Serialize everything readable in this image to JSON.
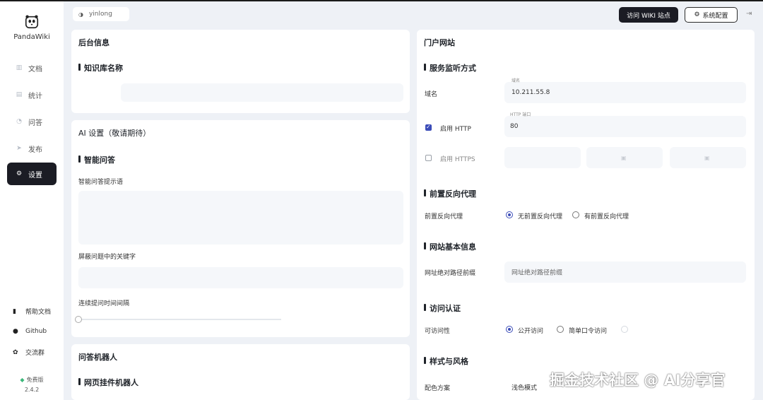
{
  "app": {
    "name": "PandaWiki",
    "version_badge": "免费版",
    "version": "2.4.2"
  },
  "sidebar": {
    "items": [
      {
        "label": "文档",
        "icon": "doc-icon"
      },
      {
        "label": "统计",
        "icon": "chart-icon"
      },
      {
        "label": "问答",
        "icon": "chat-icon"
      },
      {
        "label": "发布",
        "icon": "send-icon"
      },
      {
        "label": "设置",
        "icon": "gear-icon",
        "active": true
      }
    ],
    "bottom": [
      {
        "label": "帮助文档",
        "icon": "book-icon"
      },
      {
        "label": "Github",
        "icon": "github-icon"
      },
      {
        "label": "交流群",
        "icon": "group-icon"
      }
    ]
  },
  "topbar": {
    "user": "yinlong",
    "visit_wiki": "访问 WIKI 站点",
    "system_config": "系统配置"
  },
  "left": {
    "backend": {
      "title": "后台信息",
      "kb_name_section": "知识库名称",
      "kb_name_value": ""
    },
    "ai": {
      "title": "AI 设置（敬请期待）",
      "section": "智能问答",
      "prompt_label": "智能问答提示语",
      "prompt_placeholder": "",
      "blocked_label": "屏蔽问题中的关键字",
      "blocked_placeholder": "",
      "interval_label": "连续提问时间间隔"
    },
    "robot": {
      "title": "问答机器人",
      "section": "网页挂件机器人"
    }
  },
  "right": {
    "title": "门户网站",
    "listen": {
      "section": "服务监听方式",
      "domain_label": "域名",
      "domain_field_label": "域名",
      "domain_value": "10.211.55.8",
      "http_label": "启用 HTTP",
      "http_checked": true,
      "http_port_label": "HTTP 端口",
      "http_port_value": "80",
      "https_label": "启用 HTTPS",
      "https_checked": false,
      "https_port_label": "",
      "https_cert_label": "",
      "https_key_label": ""
    },
    "proxy": {
      "section": "前置反向代理",
      "hint": "",
      "label": "前置反向代理",
      "options": [
        "无前置反向代理",
        "有前置反向代理"
      ],
      "selected": "无前置反向代理"
    },
    "basic": {
      "section": "网站基本信息",
      "prefix_label": "网址绝对路径前缀",
      "prefix_placeholder": "网址绝对路径前缀"
    },
    "auth": {
      "section": "访问认证",
      "label": "可访问性",
      "options": [
        "公开访问",
        "简单口令访问"
      ],
      "disabled_option": "",
      "selected": "公开访问"
    },
    "style": {
      "section": "样式与风格",
      "scheme_label": "配色方案",
      "scheme_value": "浅色模式"
    }
  },
  "watermark": "掘金技术社区 @ AI分享官",
  "colors": {
    "accent": "#3b4cb8",
    "dark": "#1b1c24",
    "background": "#eef1f6",
    "card": "#ffffff"
  }
}
